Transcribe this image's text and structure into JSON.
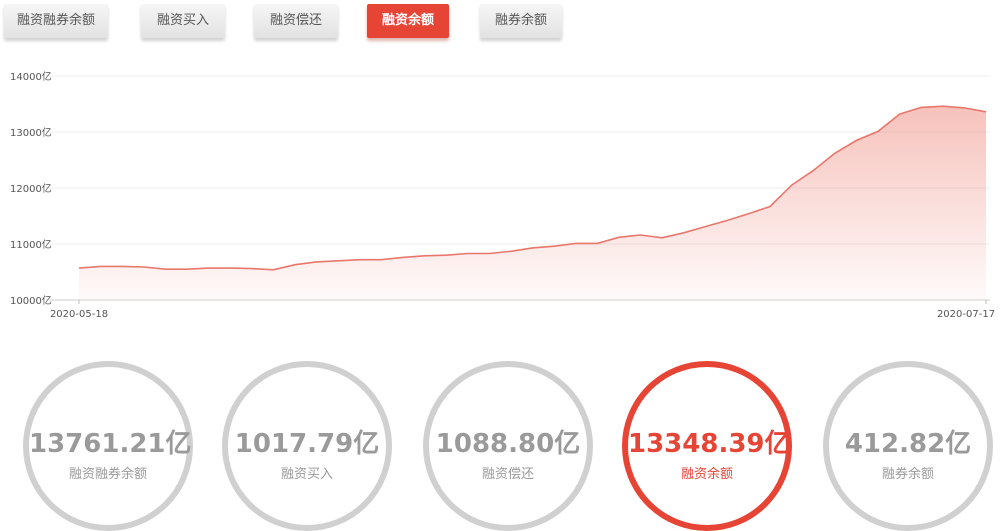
{
  "tabs": [
    {
      "label": "融资融券余额",
      "active": false
    },
    {
      "label": "融资买入",
      "active": false
    },
    {
      "label": "融资偿还",
      "active": false
    },
    {
      "label": "融资余额",
      "active": true
    },
    {
      "label": "融券余额",
      "active": false
    }
  ],
  "summary": [
    {
      "value": "13761.21亿",
      "label": "融资融券余额",
      "active": false
    },
    {
      "value": "1017.79亿",
      "label": "融资买入",
      "active": false
    },
    {
      "value": "1088.80亿",
      "label": "融资偿还",
      "active": false
    },
    {
      "value": "13348.39亿",
      "label": "融资余额",
      "active": true
    },
    {
      "value": "412.82亿",
      "label": "融券余额",
      "active": false
    }
  ],
  "colors": {
    "accent": "#e64435",
    "line": "#e8776c",
    "inactive": "#d0d0d0"
  },
  "chart_data": {
    "type": "area",
    "x_start_label": "2020-05-18",
    "x_end_label": "2020-07-17",
    "ylim": [
      10000,
      14000
    ],
    "yticks": [
      10000,
      11000,
      12000,
      13000,
      14000
    ],
    "ytick_labels": [
      "10000亿",
      "11000亿",
      "12000亿",
      "13000亿",
      "14000亿"
    ],
    "grid": true,
    "series": [
      {
        "values": [
          10570,
          10600,
          10600,
          10590,
          10550,
          10550,
          10570,
          10570,
          10560,
          10540,
          10630,
          10680,
          10700,
          10720,
          10720,
          10760,
          10790,
          10800,
          10830,
          10830,
          10870,
          10930,
          10960,
          11010,
          11010,
          11120,
          11160,
          11110,
          11200,
          11310,
          11420,
          11540,
          11670,
          12050,
          12310,
          12620,
          12850,
          13010,
          13320,
          13440,
          13460,
          13430,
          13360
        ]
      }
    ]
  }
}
